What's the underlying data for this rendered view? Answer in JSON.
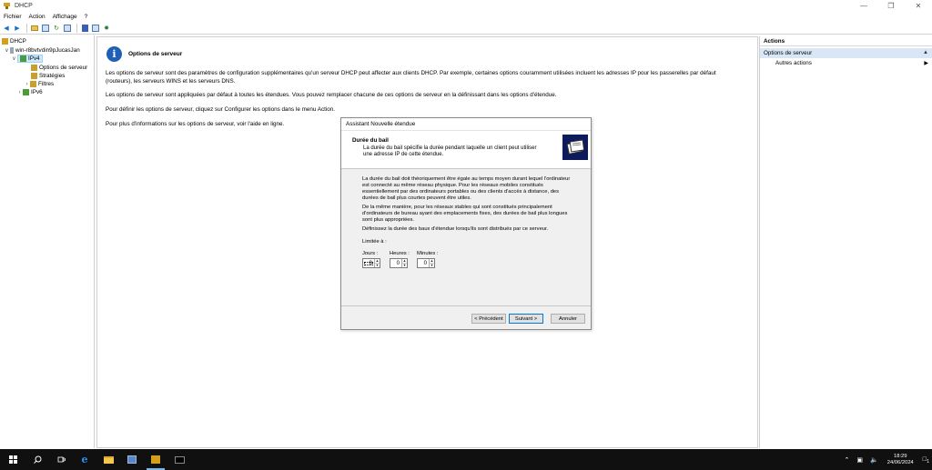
{
  "window": {
    "title": "DHCP"
  },
  "menu": [
    "Fichier",
    "Action",
    "Affichage",
    "?"
  ],
  "tree": {
    "root": "DHCP",
    "server": "win-r8bvtvdin9pJucasJan",
    "ipv4": "IPv4",
    "ipv4_children": [
      "Options de serveur",
      "Stratégies",
      "Filtres"
    ],
    "ipv6": "IPv6"
  },
  "main": {
    "heading": "Options de serveur",
    "paragraphs": [
      "Les options de serveur sont des paramètres de configuration supplémentaires qu'un serveur DHCP peut affecter aux clients DHCP. Par exemple, certaines options couramment utilisées incluent les adresses IP pour les passerelles par défaut (routeurs), les serveurs WINS et les serveurs DNS.",
      "Les options de serveur sont appliquées par défaut à toutes les étendues. Vous pouvez remplacer chacune de ces options de serveur en la définissant dans les options d'étendue.",
      "Pour définir les options de serveur, cliquez sur Configurer les options dans le menu Action.",
      "Pour plus d'informations sur les options de serveur, voir l'aide en ligne."
    ]
  },
  "wizard": {
    "title": "Assistant Nouvelle étendue",
    "header_title": "Durée du bail",
    "header_desc": "La durée du bail spécifie la durée pendant laquelle un client peut utiliser une adresse IP de cette étendue.",
    "body_p1": "La durée du bail doit théoriquement être égale au temps moyen durant lequel l'ordinateur est connecté au même réseau physique. Pour les réseaux mobiles constitués essentiellement par des ordinateurs portables ou des clients d'accès à distance, des durées de bail plus courtes peuvent être utiles.",
    "body_p2": "De la même manière, pour les réseaux stables qui sont constitués principalement d'ordinateurs de bureau ayant des emplacements fixes, des durées de bail plus longues sont plus appropriées.",
    "body_p3": "Définissez la durée des baux d'étendue lorsqu'ils sont distribués par ce serveur.",
    "limited_label": "Limitée à :",
    "days_label": "Jours :",
    "hours_label": "Heures :",
    "minutes_label": "Minutes :",
    "days_value": "8",
    "hours_value": "0",
    "minutes_value": "0",
    "btn_prev": "< Précédent",
    "btn_next": "Suivant >",
    "btn_cancel": "Annuler"
  },
  "actions": {
    "header": "Actions",
    "section": "Options de serveur",
    "item": "Autres actions"
  },
  "taskbar": {
    "time": "18:29",
    "date": "24/06/2024",
    "notification_count": "1"
  },
  "colors": {
    "selection": "#cce8ff",
    "actions_section": "#d9e6f6",
    "taskbar": "#101010",
    "info_icon": "#1f5fb4"
  }
}
